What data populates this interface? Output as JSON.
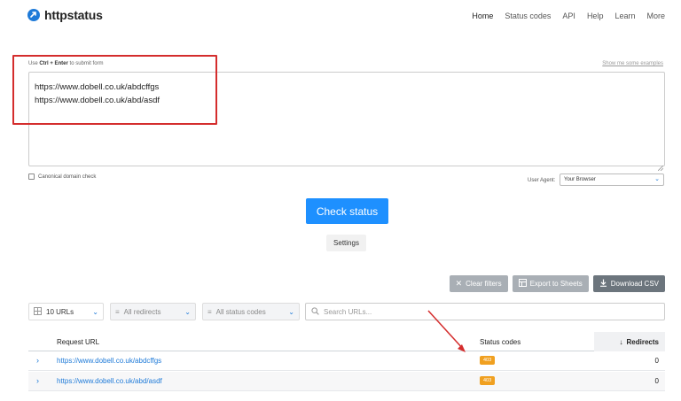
{
  "header": {
    "logo_text": "httpstatus",
    "nav": [
      "Home",
      "Status codes",
      "API",
      "Help",
      "Learn",
      "More"
    ]
  },
  "form": {
    "hint_prefix": "Use ",
    "hint_keys": "Ctrl + Enter",
    "hint_suffix": " to submit form",
    "examples_link": "Show me some examples",
    "urls_value": "https://www.dobell.co.uk/abdcffgs\nhttps://www.dobell.co.uk/abd/asdf",
    "canonical_label": "Canonical domain check",
    "user_agent_label": "User Agent:",
    "user_agent_value": "Your Browser",
    "check_button": "Check status",
    "settings_button": "Settings"
  },
  "actions": {
    "clear_filters": "Clear filters",
    "export_sheets": "Export to Sheets",
    "download_csv": "Download CSV"
  },
  "filters": {
    "urls": "10 URLs",
    "redirects": "All redirects",
    "status_codes": "All status codes",
    "search_placeholder": "Search URLs..."
  },
  "table": {
    "headers": {
      "url": "Request URL",
      "status": "Status codes",
      "redirects": "Redirects"
    },
    "rows": [
      {
        "url": "https://www.dobell.co.uk/abdcffgs",
        "status": "403",
        "redirects": "0"
      },
      {
        "url": "https://www.dobell.co.uk/abd/asdf",
        "status": "403",
        "redirects": "0"
      }
    ]
  },
  "colors": {
    "brand": "#1e7ad8",
    "primary_button": "#1e90ff",
    "badge_403": "#f0a020",
    "annotation_red": "#d42d2d"
  }
}
